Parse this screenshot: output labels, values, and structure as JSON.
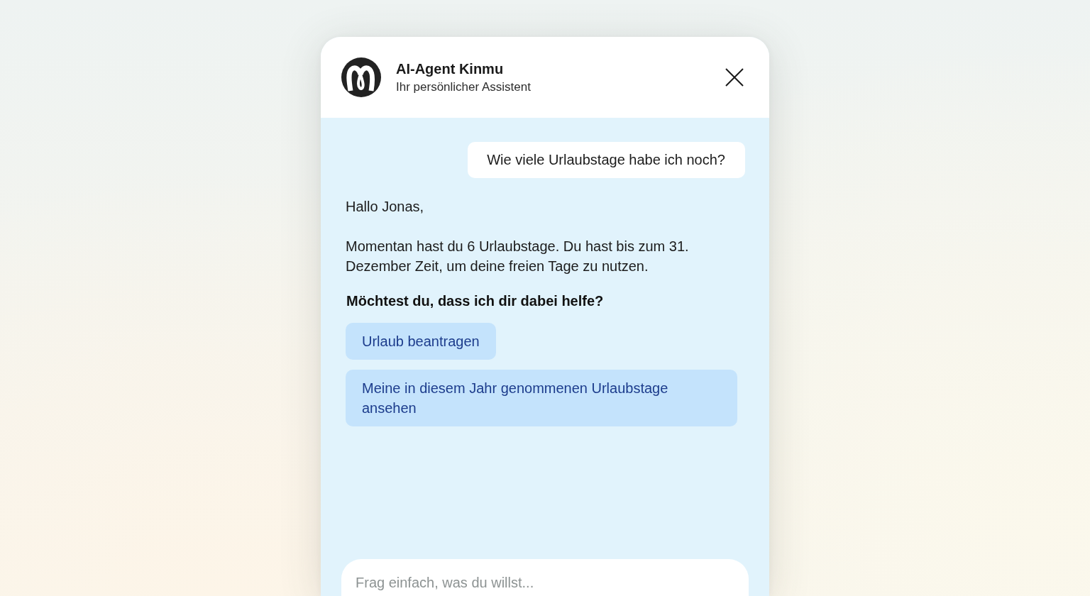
{
  "header": {
    "title": "AI-Agent Kinmu",
    "subtitle": "Ihr persönlicher Assistent"
  },
  "messages": [
    {
      "kind": "user",
      "text": "Wie viele Urlaubstage habe ich noch?"
    },
    {
      "kind": "assistant",
      "paragraphs": [
        "Hallo Jonas,",
        "Momentan hast du 6 Urlaubstage. Du hast bis zum 31. Dezember Zeit, um deine freien Tage zu nutzen."
      ],
      "question": "Möchtest du, dass ich dir dabei helfe?",
      "suggestions": [
        "Urlaub beantragen",
        "Meine in diesem Jahr genommenen Urlaubstage ansehen"
      ]
    }
  ],
  "composer": {
    "placeholder": "Frag einfach, was du willst..."
  }
}
